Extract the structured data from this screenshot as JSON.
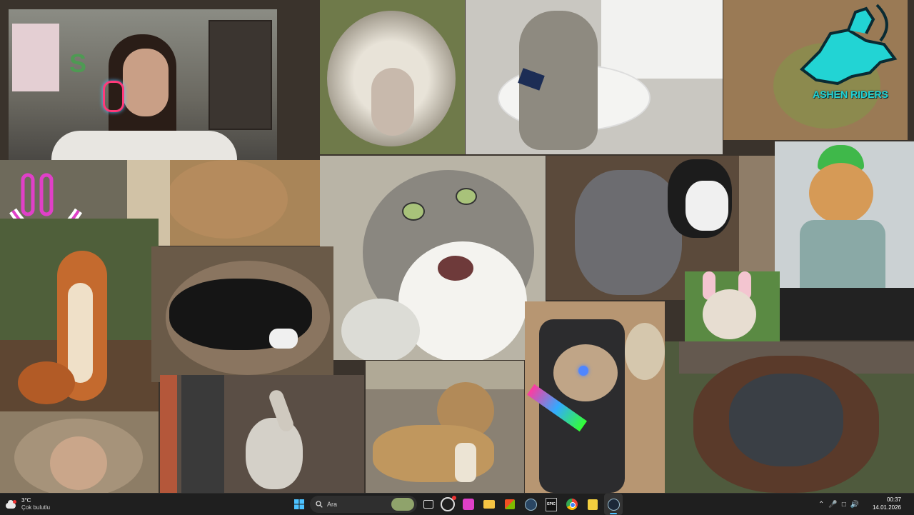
{
  "taskbar": {
    "weather": {
      "temp": "3°C",
      "condition": "Çok bulutlu"
    },
    "search": {
      "placeholder": "Ara"
    },
    "clock": {
      "time": "00:37",
      "date": "14.01.2026"
    },
    "epic_label": "EPIC"
  },
  "collage": {
    "logo_text": "ASHEN RIDERS",
    "tiles": [
      {
        "name": "streamer-webcam",
        "color": "#6d6a62"
      },
      {
        "name": "sheep-photo",
        "color": "#6f7a4a"
      },
      {
        "name": "cat-toilet-phone-photo",
        "color": "#c9c7c1"
      },
      {
        "name": "ashen-riders-logo-photo",
        "color": "#9a7a55"
      },
      {
        "name": "smiley-sticker",
        "color": "#6e6a5b"
      },
      {
        "name": "fluffy-cat-photo",
        "color": "#a98558"
      },
      {
        "name": "shocked-cat-photo",
        "color": "#b9b4a6"
      },
      {
        "name": "dog-cat-fight-photo",
        "color": "#5b4a3b"
      },
      {
        "name": "green-hat-cat-photo",
        "color": "#cbd1d3"
      },
      {
        "name": "squirrel-photo",
        "color": "#4f5f3a"
      },
      {
        "name": "black-dog-controller-photo",
        "color": "#6a5a48"
      },
      {
        "name": "bunny-ears-dog-photo",
        "color": "#5a8a43"
      },
      {
        "name": "gamer-cat-chair-photo",
        "color": "#b79672"
      },
      {
        "name": "orangutan-photo",
        "color": "#4f5a3d"
      },
      {
        "name": "monkey-photo",
        "color": "#8d7d66"
      },
      {
        "name": "donkey-photo",
        "color": "#5a4e45"
      },
      {
        "name": "dogs-bread-photo",
        "color": "#8a8173"
      }
    ]
  }
}
